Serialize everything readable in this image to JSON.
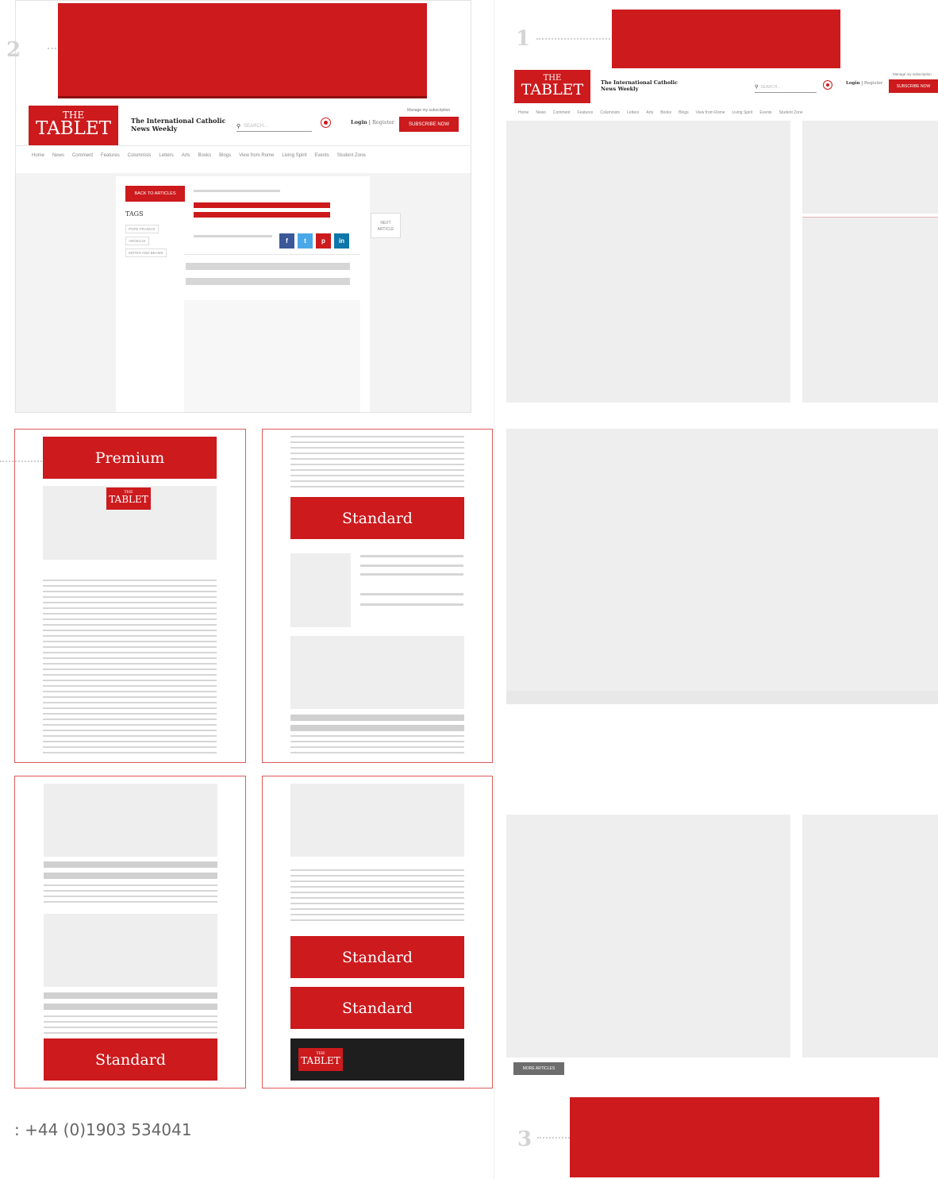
{
  "markers": {
    "one": "1",
    "two": "2",
    "three": "3"
  },
  "header": {
    "logo_the": "THE",
    "logo_tablet": "TABLET",
    "tagline_1": "The International Catholic",
    "tagline_2": "News Weekly",
    "search_placeholder": "SEARCH...",
    "login_label": "Login",
    "separator": "|",
    "register_label": "Register",
    "manage_label": "Manage my subscription",
    "subscribe_label": "SUBSCRIBE NOW"
  },
  "nav": [
    "Home",
    "News",
    "Comment",
    "Features",
    "Columnists",
    "Letters",
    "Arts",
    "Books",
    "Blogs",
    "View from Rome",
    "Living Spirit",
    "Events",
    "Student Zone"
  ],
  "article": {
    "back_label": "BACK TO ARTICLES",
    "tags_heading": "TAGS",
    "tags": [
      "POPE FRANCIS",
      "ANGELUS",
      "MOTES AND BEAMS"
    ],
    "next_line1": "NEXT",
    "next_line2": "ARTICLE",
    "social": [
      "f",
      "t",
      "p",
      "in"
    ]
  },
  "cards": {
    "premium": "Premium",
    "standard": "Standard"
  },
  "more_articles": "MORE ARTICLES",
  "phone": ": +44 (0)1903 534041",
  "colors": {
    "brand_red": "#cc1a1d",
    "placeholder_grey": "#eeeeee",
    "dark": "#1e1e1e"
  },
  "icons": [
    "search-icon",
    "user-icon",
    "facebook-icon",
    "twitter-icon",
    "pinterest-icon",
    "linkedin-icon"
  ]
}
